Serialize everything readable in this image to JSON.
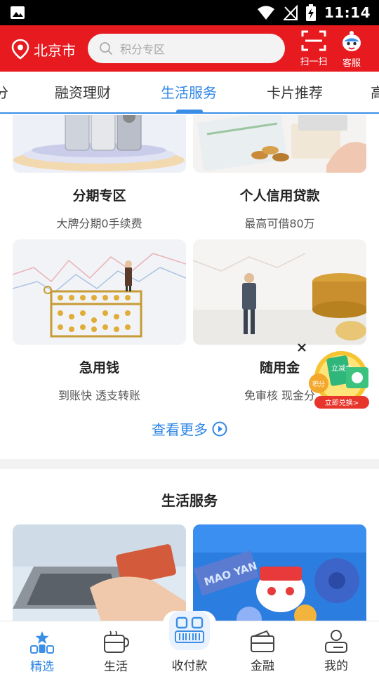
{
  "status_bar": {
    "time": "11:14"
  },
  "header": {
    "city": "北京市",
    "search_placeholder": "积分专区",
    "scan_label": "扫一扫",
    "service_label": "客服"
  },
  "tabs": [
    {
      "label": "分"
    },
    {
      "label": "融资理财"
    },
    {
      "label": "生活服务",
      "active": true
    },
    {
      "label": "卡片推荐"
    },
    {
      "label": "高"
    }
  ],
  "cards": [
    {
      "title": "分期专区",
      "subtitle": "大牌分期0手续费"
    },
    {
      "title": "个人信用贷款",
      "subtitle": "最高可借80万"
    },
    {
      "title": "急用钱",
      "subtitle": "到账快 透支转账"
    },
    {
      "title": "随用金",
      "subtitle": "免审核 现金分"
    }
  ],
  "more_label": "查看更多",
  "section2": {
    "title": "生活服务",
    "movie_sign": "MAO YAN"
  },
  "promo": {
    "button": "立即兑换>",
    "badge_text": "立减金",
    "coin_text": "积分"
  },
  "bottom_nav": [
    {
      "label": "精选",
      "active": true
    },
    {
      "label": "生活"
    },
    {
      "label": "收付款"
    },
    {
      "label": "金融"
    },
    {
      "label": "我的"
    }
  ],
  "colors": {
    "brand_red": "#e61a1f",
    "accent_blue": "#2f86e6"
  }
}
